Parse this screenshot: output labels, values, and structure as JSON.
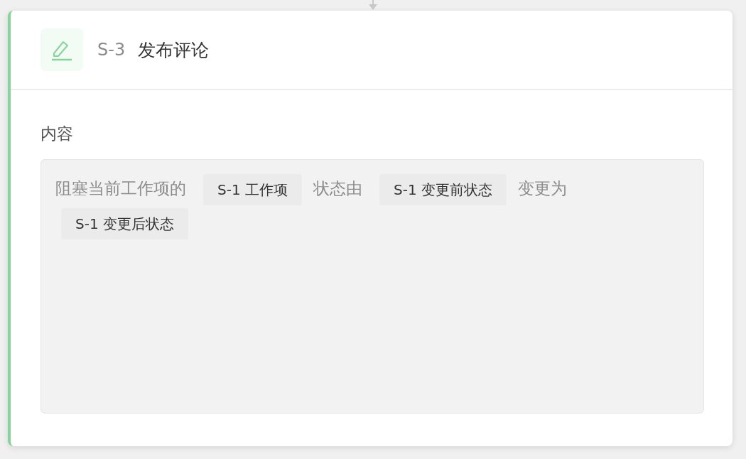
{
  "step": {
    "id": "S-3",
    "title": "发布评论"
  },
  "field": {
    "label": "内容",
    "content": [
      {
        "kind": "text",
        "text": "阻塞当前工作项的"
      },
      {
        "kind": "token",
        "text": "S-1 工作项"
      },
      {
        "kind": "text",
        "text": "状态由"
      },
      {
        "kind": "token",
        "text": "S-1 变更前状态"
      },
      {
        "kind": "text",
        "text": "变更为"
      },
      {
        "kind": "token",
        "text": "S-1 变更后状态"
      }
    ]
  }
}
